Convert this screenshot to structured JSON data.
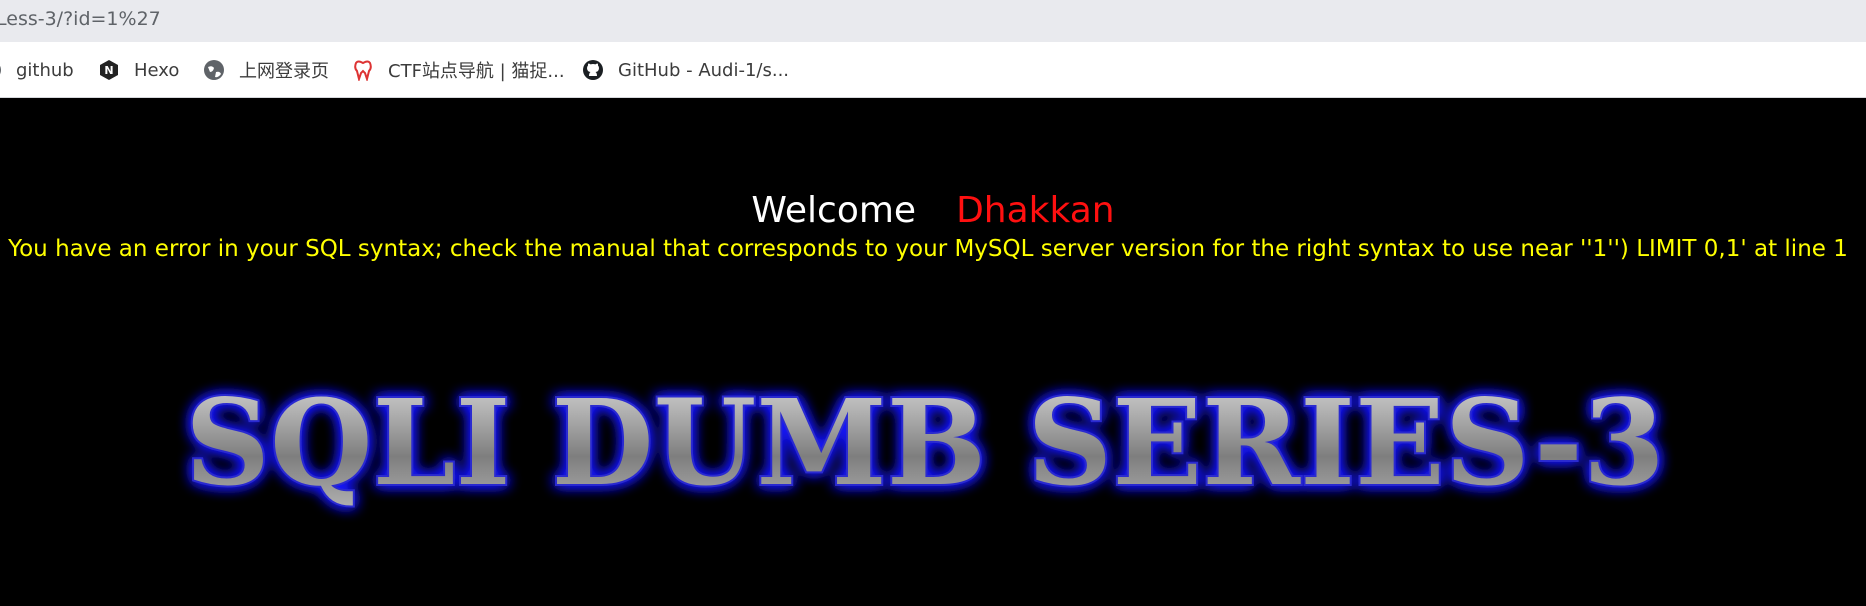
{
  "browser": {
    "address_bar_text": "Less-3/?id=1%27",
    "bookmarks": [
      {
        "label": "github",
        "icon": "globe-icon"
      },
      {
        "label": "Hexo",
        "icon": "hexo-icon"
      },
      {
        "label": "上网登录页",
        "icon": "globe-icon"
      },
      {
        "label": "CTF站点导航 | 猫捉...",
        "icon": "tooth-icon"
      },
      {
        "label": "GitHub - Audi-1/s...",
        "icon": "github-icon"
      }
    ]
  },
  "page": {
    "welcome_word": "Welcome",
    "welcome_name": "Dhakkan",
    "error_message": "You have an error in your SQL syntax; check the manual that corresponds to your MySQL server version for the right syntax to use near ''1'') LIMIT 0,1' at line 1",
    "series_title": "SQLI DUMB SERIES-3"
  },
  "colors": {
    "page_background": "#000000",
    "welcome_word": "#ffffff",
    "welcome_name": "#ff1010",
    "error_message": "#ffff00",
    "title_glow": "#1a1aff",
    "title_metal": "#9a9a9a"
  }
}
